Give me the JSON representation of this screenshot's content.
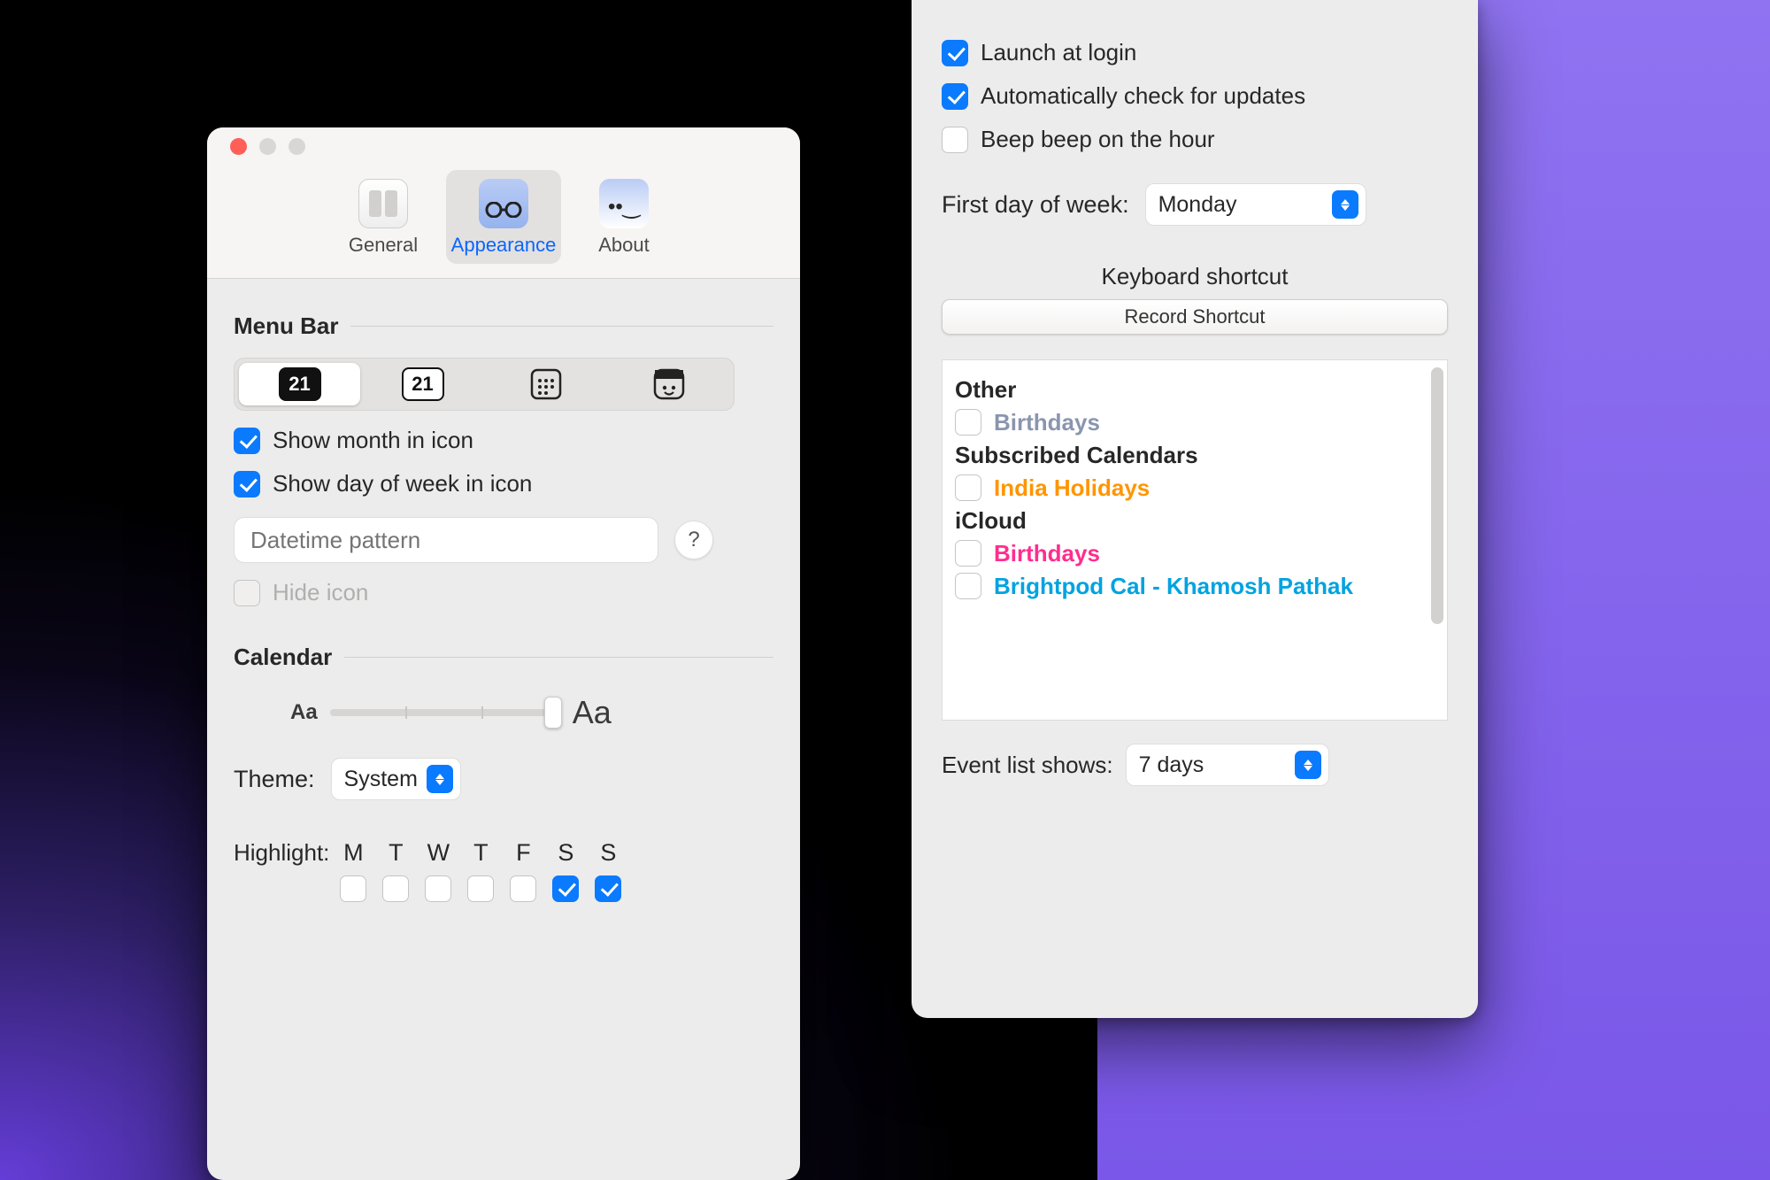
{
  "leftWindow": {
    "tabs": {
      "general": "General",
      "appearance": "Appearance",
      "about": "About"
    },
    "menuBar": {
      "heading": "Menu Bar",
      "iconStyleSelected": 0,
      "iconStyles": [
        "21",
        "21",
        "grid",
        "face"
      ],
      "showMonth": {
        "label": "Show month in icon",
        "checked": true
      },
      "showDow": {
        "label": "Show day of week in icon",
        "checked": true
      },
      "patternPlaceholder": "Datetime pattern",
      "help": "?",
      "hideIcon": {
        "label": "Hide icon",
        "checked": false,
        "disabled": true
      }
    },
    "calendar": {
      "heading": "Calendar",
      "aaSmall": "Aa",
      "aaBig": "Aa",
      "themeLabel": "Theme:",
      "themeValue": "System",
      "highlightLabel": "Highlight:",
      "days": [
        {
          "d": "M",
          "on": false
        },
        {
          "d": "T",
          "on": false
        },
        {
          "d": "W",
          "on": false
        },
        {
          "d": "T",
          "on": false
        },
        {
          "d": "F",
          "on": false
        },
        {
          "d": "S",
          "on": true
        },
        {
          "d": "S",
          "on": true
        }
      ]
    }
  },
  "rightWindow": {
    "launch": {
      "label": "Launch at login",
      "checked": true
    },
    "updates": {
      "label": "Automatically check for updates",
      "checked": true
    },
    "beep": {
      "label": "Beep beep on the hour",
      "checked": false
    },
    "firstDow": {
      "label": "First day of week:",
      "value": "Monday"
    },
    "shortcut": {
      "heading": "Keyboard shortcut",
      "button": "Record Shortcut"
    },
    "calendars": {
      "groups": [
        {
          "name": "Other",
          "items": [
            {
              "name": "Birthdays",
              "cls": "c-bday1",
              "on": false
            }
          ]
        },
        {
          "name": "Subscribed Calendars",
          "items": [
            {
              "name": "India Holidays",
              "cls": "c-india",
              "on": false
            }
          ]
        },
        {
          "name": "iCloud",
          "items": [
            {
              "name": "Birthdays",
              "cls": "c-bday2",
              "on": false
            },
            {
              "name": "Brightpod Cal - Khamosh Pathak",
              "cls": "c-bp",
              "on": false
            }
          ]
        }
      ]
    },
    "eventList": {
      "label": "Event list shows:",
      "value": "7 days"
    }
  }
}
